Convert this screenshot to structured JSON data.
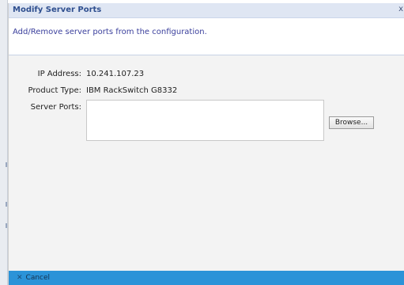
{
  "dialog": {
    "title": "Modify Server Ports",
    "close_symbol": "x",
    "description": "Add/Remove server ports from the configuration."
  },
  "form": {
    "ip_address_label": "IP Address:",
    "ip_address_value": "10.241.107.23",
    "product_type_label": "Product Type:",
    "product_type_value": "IBM RackSwitch G8332",
    "server_ports_label": "Server Ports:",
    "server_ports_value": "",
    "browse_label": "Browse..."
  },
  "footer": {
    "cancel_label": "Cancel",
    "cancel_icon": "cancel-icon"
  },
  "colors": {
    "title_text": "#2f4f8f",
    "description_text": "#3a3f9c",
    "titlebar_bg": "#dfe6f3",
    "footer_bg": "#2b93d8"
  }
}
